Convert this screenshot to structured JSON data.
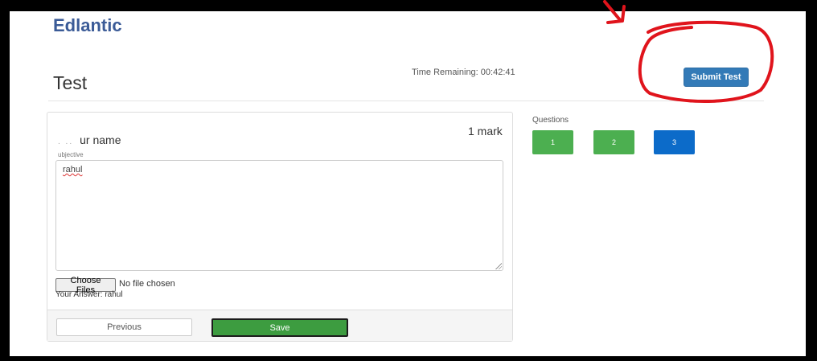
{
  "header": {
    "brand": "Edlantic",
    "page_title": "Test",
    "timer": "Time Remaining: 00:42:41",
    "submit_label": "Submit Test"
  },
  "question": {
    "text": "ur name",
    "marks": "1 mark",
    "type_label": "ubjective",
    "answer_value": "rahul",
    "file_button_label": "Choose Files",
    "file_status": "No file chosen",
    "your_answer": "Your Answer: rahul"
  },
  "footer": {
    "previous_label": "Previous",
    "save_label": "Save"
  },
  "question_nav": {
    "label": "Questions",
    "items": [
      {
        "number": "1",
        "state": "answered"
      },
      {
        "number": "2",
        "state": "answered"
      },
      {
        "number": "3",
        "state": "current"
      }
    ]
  },
  "colors": {
    "brand": "#3b5b97",
    "submit": "#337ab7",
    "answered": "#4caf50",
    "current": "#0c6bc9",
    "save": "#3d9c40",
    "annotation": "#e0141c"
  }
}
